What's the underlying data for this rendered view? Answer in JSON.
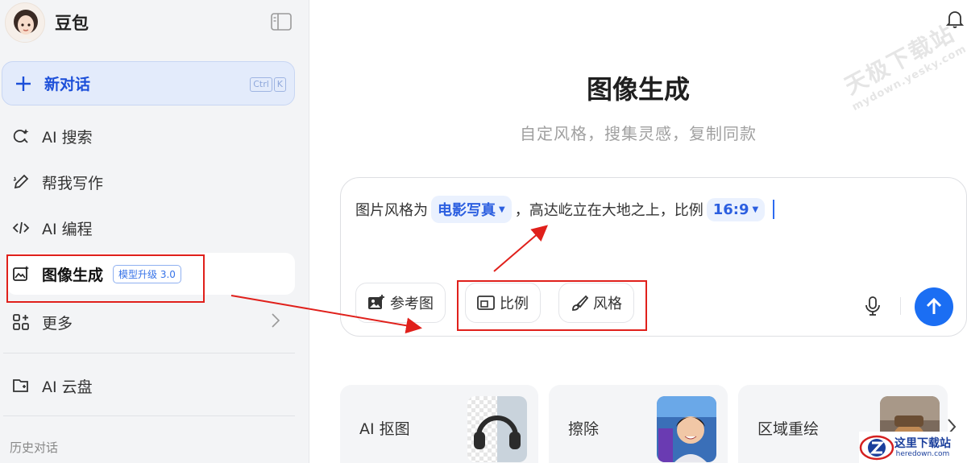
{
  "sidebar": {
    "brand_name": "豆包",
    "new_chat": {
      "label": "新对话",
      "shortcut_keys": [
        "Ctrl",
        "K"
      ]
    },
    "items": [
      {
        "label": "AI 搜索",
        "icon": "search-icon"
      },
      {
        "label": "帮我写作",
        "icon": "pen-icon"
      },
      {
        "label": "AI 编程",
        "icon": "code-icon"
      },
      {
        "label": "图像生成",
        "icon": "image-sparkle-icon",
        "badge": "模型升级 3.0",
        "active": true
      },
      {
        "label": "更多",
        "icon": "grid-plus-icon"
      },
      {
        "label": "AI 云盘",
        "icon": "cloud-folder-icon"
      }
    ],
    "history_label": "历史对话"
  },
  "main": {
    "title": "图像生成",
    "subtitle": "自定风格，搜集灵感，复制同款",
    "prompt": {
      "prefix": "图片风格为",
      "style_chip": "电影写真",
      "middle": "，高达屹立在大地之上，比例",
      "ratio_chip": "16:9"
    },
    "tools": {
      "reference": "参考图",
      "ratio": "比例",
      "style": "风格"
    },
    "cards": [
      {
        "label": "AI 抠图"
      },
      {
        "label": "擦除"
      },
      {
        "label": "区域重绘"
      }
    ]
  },
  "watermark": {
    "line1": "天极下载站",
    "line2": "mydown.yesky.com"
  },
  "site_logo": {
    "line1": "这里下载站",
    "line2": "heredown.com"
  },
  "colors": {
    "accent": "#1b6ef3",
    "annotation": "#e0201b",
    "chip_bg": "#eaf1fe"
  }
}
